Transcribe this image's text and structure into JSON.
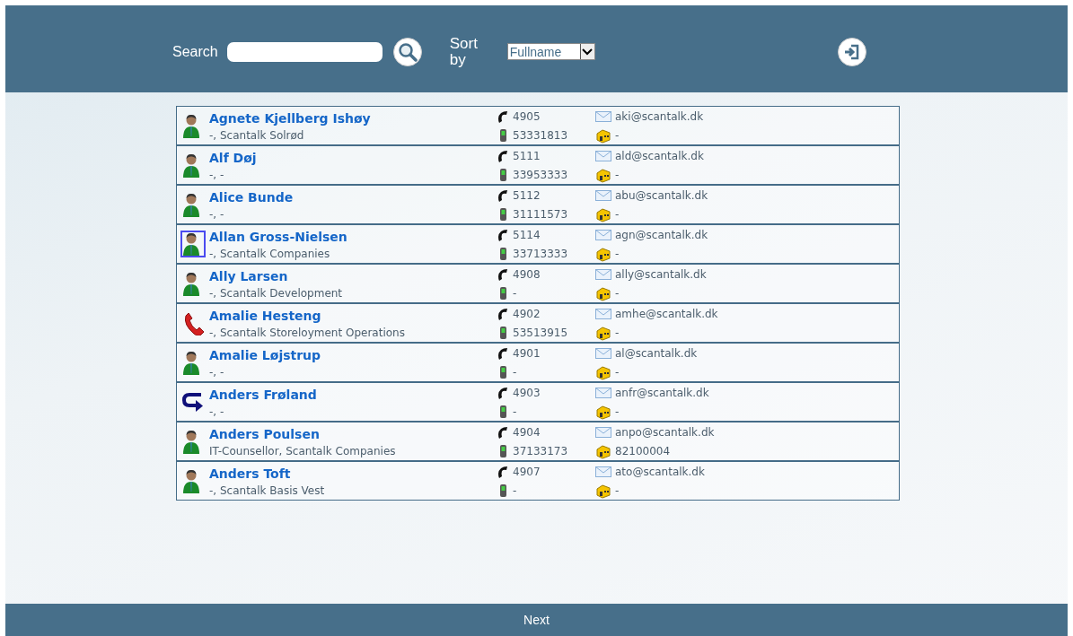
{
  "header": {
    "search_label": "Search",
    "sort_label": "Sort by",
    "sort": {
      "value": "Fullname"
    }
  },
  "contacts": [
    {
      "name": "Agnete Kjellberg Ishøy",
      "details": "-, Scantalk Solrød",
      "phone": "4905",
      "mobile": "53331813",
      "email": "aki@scantalk.dk",
      "other": "-",
      "kind": "available",
      "selected": false
    },
    {
      "name": "Alf Døj",
      "details": "-, -",
      "phone": "5111",
      "mobile": "33953333",
      "email": "ald@scantalk.dk",
      "other": "-",
      "kind": "available",
      "selected": false
    },
    {
      "name": "Alice Bunde",
      "details": "-, -",
      "phone": "5112",
      "mobile": "31111573",
      "email": "abu@scantalk.dk",
      "other": "-",
      "kind": "available",
      "selected": false
    },
    {
      "name": "Allan Gross-Nielsen",
      "details": "-, Scantalk Companies",
      "phone": "5114",
      "mobile": "33713333",
      "email": "agn@scantalk.dk",
      "other": "-",
      "kind": "available",
      "selected": true
    },
    {
      "name": "Ally Larsen",
      "details": "-, Scantalk Development",
      "phone": "4908",
      "mobile": "-",
      "email": "ally@scantalk.dk",
      "other": "-",
      "kind": "available",
      "selected": false
    },
    {
      "name": "Amalie Hesteng",
      "details": "-, Scantalk Storeloyment Operations",
      "phone": "4902",
      "mobile": "53513915",
      "email": "amhe@scantalk.dk",
      "other": "-",
      "kind": "busy",
      "selected": false
    },
    {
      "name": "Amalie Løjstrup",
      "details": "-, -",
      "phone": "4901",
      "mobile": "-",
      "email": "al@scantalk.dk",
      "other": "-",
      "kind": "available",
      "selected": false
    },
    {
      "name": "Anders Frøland",
      "details": "-, -",
      "phone": "4903",
      "mobile": "-",
      "email": "anfr@scantalk.dk",
      "other": "-",
      "kind": "forwarded",
      "selected": false
    },
    {
      "name": "Anders Poulsen",
      "details": "IT-Counsellor, Scantalk Companies",
      "phone": "4904",
      "mobile": "37133173",
      "email": "anpo@scantalk.dk",
      "other": "82100004",
      "kind": "available",
      "selected": false
    },
    {
      "name": "Anders Toft",
      "details": "-, Scantalk Basis Vest",
      "phone": "4907",
      "mobile": "-",
      "email": "ato@scantalk.dk",
      "other": "-",
      "kind": "available",
      "selected": false
    }
  ],
  "footer": {
    "next": "Next"
  }
}
